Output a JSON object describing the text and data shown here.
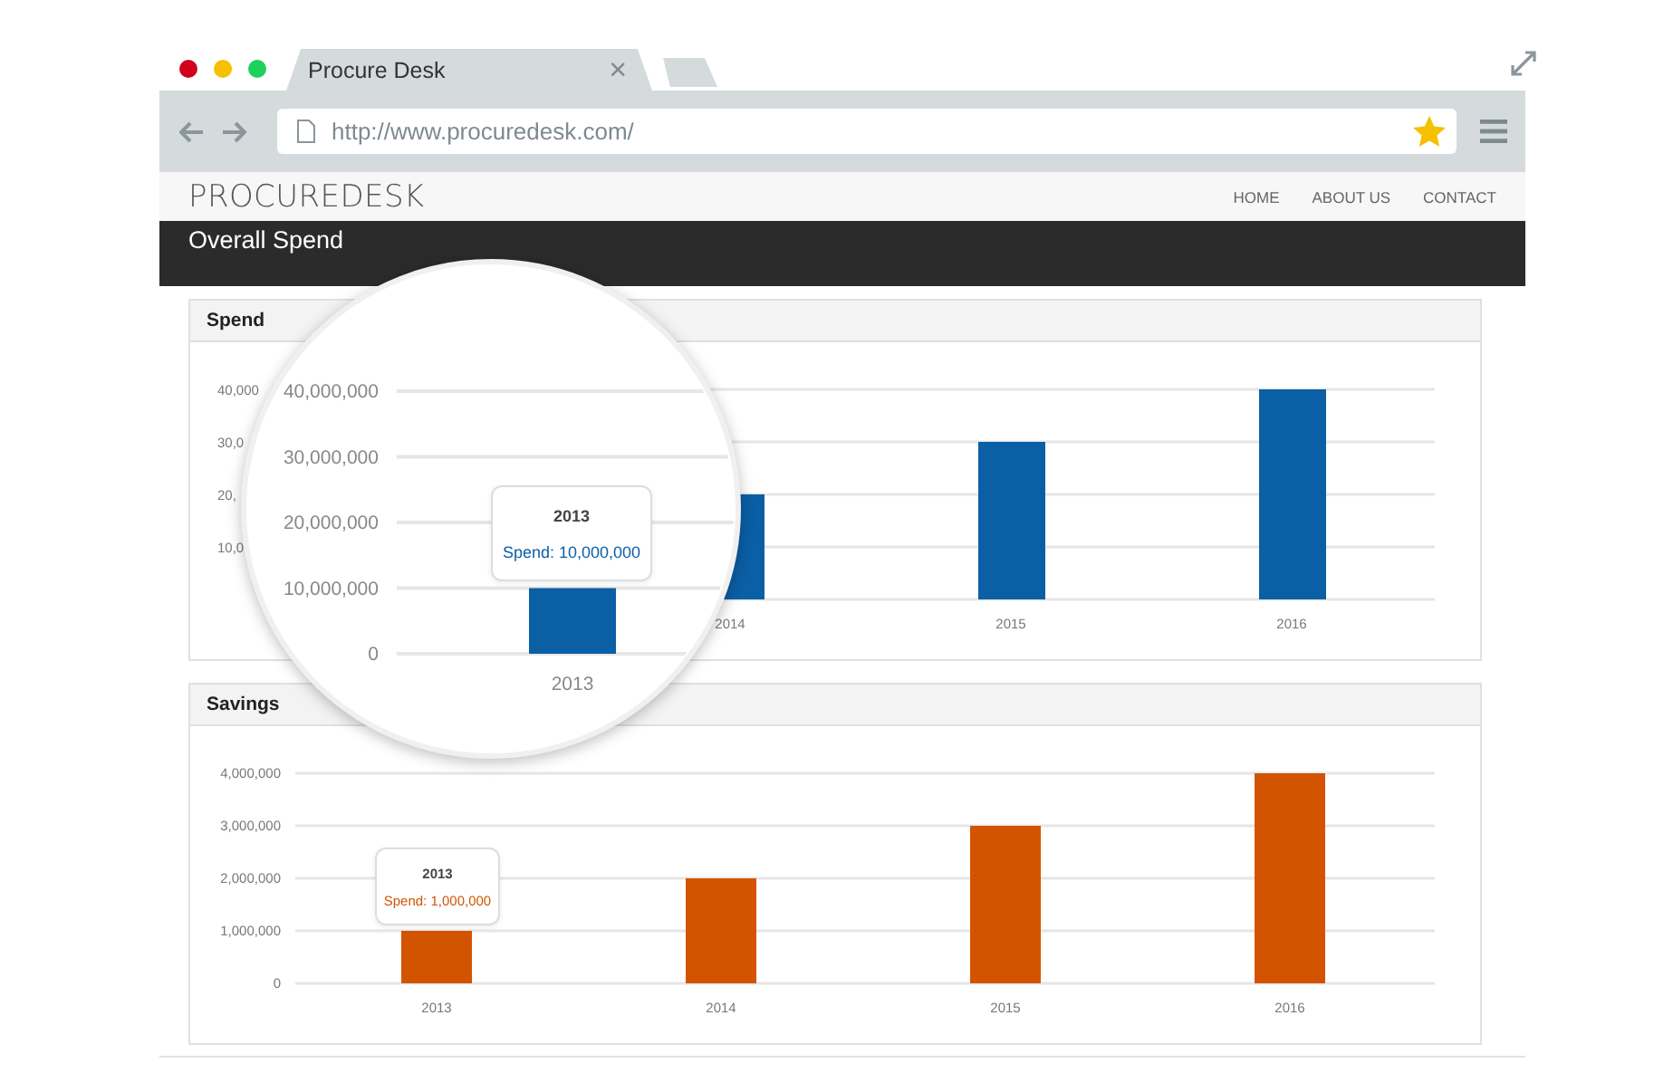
{
  "browser": {
    "tab_title": "Procure Desk",
    "close": "×",
    "url": "http://www.procuredesk.com/"
  },
  "site": {
    "logo": "PROCUREDESK",
    "nav": [
      {
        "label": "HOME"
      },
      {
        "label": "ABOUT US"
      },
      {
        "label": "CONTACT"
      }
    ],
    "page_title": "Overall Spend"
  },
  "panels": [
    {
      "kind": "magnified",
      "title": "Spend",
      "background_ytick_labels": [
        "40,000",
        "30,0",
        "20,",
        "10,0"
      ],
      "background_categories": [
        "2014",
        "2015",
        "2016"
      ],
      "tooltip": {
        "title": "2013",
        "text": "Spend: 10,000,000"
      },
      "chart_data": {
        "type": "bar",
        "categories": [
          "2013"
        ],
        "series": [
          {
            "color": "#0b5fa5",
            "values": [
              10000000
            ]
          }
        ],
        "ylim": [
          0,
          40000000
        ],
        "grid": true,
        "yticks": [
          {
            "value": 0,
            "label": "0"
          },
          {
            "value": 10000000,
            "label": "10,000,000"
          },
          {
            "value": 20000000,
            "label": "20,000,000"
          },
          {
            "value": 30000000,
            "label": "30,000,000"
          },
          {
            "value": 40000000,
            "label": "40,000,000"
          }
        ]
      }
    },
    {
      "kind": "plain",
      "title": "Savings",
      "tooltip": {
        "title": "2013",
        "text": "Spend: 1,000,000"
      },
      "chart_data": {
        "type": "bar",
        "categories": [
          "2013",
          "2014",
          "2015",
          "2016"
        ],
        "series": [
          {
            "color": "#d35400",
            "values": [
              1000000,
              2000000,
              3000000,
              4000000
            ]
          }
        ],
        "ylim": [
          0,
          4000000
        ],
        "grid": true,
        "yticks": [
          {
            "value": 0,
            "label": "0"
          },
          {
            "value": 1000000,
            "label": "1,000,000"
          },
          {
            "value": 2000000,
            "label": "2,000,000"
          },
          {
            "value": 3000000,
            "label": "3,000,000"
          },
          {
            "value": 4000000,
            "label": "4,000,000"
          }
        ]
      }
    }
  ]
}
